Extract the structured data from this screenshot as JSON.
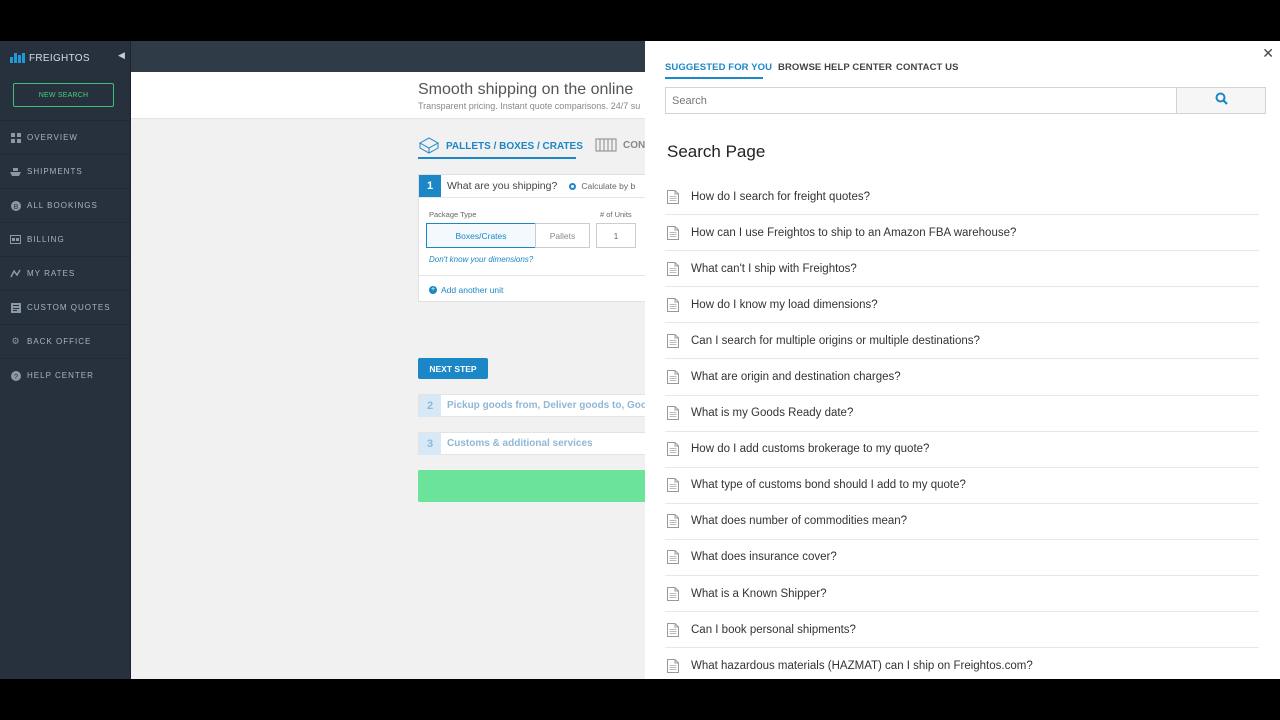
{
  "sidebar": {
    "logo_text": "FREIGHTOS",
    "new_search_label": "NEW SEARCH",
    "items": [
      {
        "label": "OVERVIEW",
        "icon": "dashboard-icon"
      },
      {
        "label": "SHIPMENTS",
        "icon": "ship-icon"
      },
      {
        "label": "ALL BOOKINGS",
        "icon": "bookings-icon"
      },
      {
        "label": "BILLING",
        "icon": "billing-icon"
      },
      {
        "label": "MY RATES",
        "icon": "rates-icon"
      },
      {
        "label": "CUSTOM QUOTES",
        "icon": "quotes-icon"
      },
      {
        "label": "BACK OFFICE",
        "icon": "gear-icon"
      },
      {
        "label": "HELP CENTER",
        "icon": "help-icon"
      }
    ]
  },
  "main": {
    "hero_title": "Smooth shipping on the online",
    "hero_subtitle": "Transparent pricing. Instant quote comparisons. 24/7 su",
    "tabs": [
      {
        "label": "PALLETS / BOXES / CRATES",
        "active": true
      },
      {
        "label": "CON",
        "active": false
      }
    ],
    "step1": {
      "number": "1",
      "question": "What are you shipping?",
      "calc_label": "Calculate by b",
      "package_type_label": "Package Type",
      "units_label": "# of Units",
      "package_options": [
        "Boxes/Crates",
        "Pallets"
      ],
      "units_value": "1",
      "dimensions_link": "Don't know your dimensions?",
      "add_unit_label": "Add another unit"
    },
    "next_step_label": "NEXT STEP",
    "step2": {
      "number": "2",
      "title": "Pickup goods from, Deliver goods to, Goo"
    },
    "step3": {
      "number": "3",
      "title": "Customs & additional services"
    }
  },
  "help": {
    "tabs": [
      "SUGGESTED FOR YOU",
      "BROWSE HELP CENTER",
      "CONTACT US"
    ],
    "search_placeholder": "Search",
    "page_title": "Search Page",
    "articles": [
      "How do I search for freight quotes?",
      "How can I use Freightos to ship to an Amazon FBA warehouse?",
      "What can't I ship with Freightos?",
      "How do I know my load dimensions?",
      "Can I search for multiple origins or multiple destinations?",
      "What are origin and destination charges?",
      "What is my Goods Ready date?",
      "How do I add customs brokerage to my quote?",
      "What type of customs bond should I add to my quote?",
      "What does number of commodities mean?",
      "What does insurance cover?",
      "What is a Known Shipper?",
      "Can I book personal shipments?",
      "What hazardous materials (HAZMAT) can I ship on Freightos.com?"
    ]
  },
  "colors": {
    "accent": "#1b87c6",
    "sidebar_bg": "#26313d",
    "new_search_green": "#45d07f",
    "cta_green": "#6ce39b"
  }
}
